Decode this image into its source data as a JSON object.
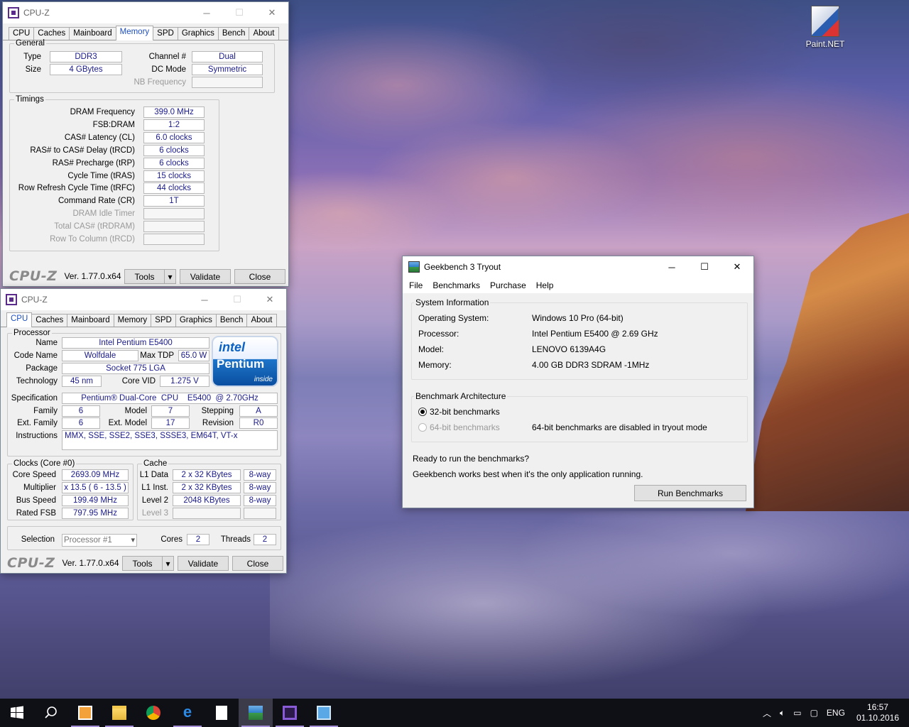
{
  "desktop": {
    "icon_label": "Paint.NET"
  },
  "cpuz_mem": {
    "title": "CPU-Z",
    "tabs": [
      "CPU",
      "Caches",
      "Mainboard",
      "Memory",
      "SPD",
      "Graphics",
      "Bench",
      "About"
    ],
    "general": {
      "legend": "General",
      "type_label": "Type",
      "type": "DDR3",
      "size_label": "Size",
      "size": "4 GBytes",
      "channel_label": "Channel #",
      "channel": "Dual",
      "dc_label": "DC Mode",
      "dc": "Symmetric",
      "nb_label": "NB Frequency",
      "nb": ""
    },
    "timings": {
      "legend": "Timings",
      "rows": [
        {
          "label": "DRAM Frequency",
          "value": "399.0 MHz",
          "disabled": false
        },
        {
          "label": "FSB:DRAM",
          "value": "1:2",
          "disabled": false
        },
        {
          "label": "CAS# Latency (CL)",
          "value": "6.0 clocks",
          "disabled": false
        },
        {
          "label": "RAS# to CAS# Delay (tRCD)",
          "value": "6 clocks",
          "disabled": false
        },
        {
          "label": "RAS# Precharge (tRP)",
          "value": "6 clocks",
          "disabled": false
        },
        {
          "label": "Cycle Time (tRAS)",
          "value": "15 clocks",
          "disabled": false
        },
        {
          "label": "Row Refresh Cycle Time (tRFC)",
          "value": "44 clocks",
          "disabled": false
        },
        {
          "label": "Command Rate (CR)",
          "value": "1T",
          "disabled": false
        },
        {
          "label": "DRAM Idle Timer",
          "value": "",
          "disabled": true
        },
        {
          "label": "Total CAS# (tRDRAM)",
          "value": "",
          "disabled": true
        },
        {
          "label": "Row To Column (tRCD)",
          "value": "",
          "disabled": true
        }
      ]
    },
    "footer": {
      "brand": "CPU-Z",
      "version": "Ver. 1.77.0.x64",
      "tools": "Tools",
      "validate": "Validate",
      "close": "Close"
    }
  },
  "cpuz_cpu": {
    "title": "CPU-Z",
    "tabs": [
      "CPU",
      "Caches",
      "Mainboard",
      "Memory",
      "SPD",
      "Graphics",
      "Bench",
      "About"
    ],
    "processor": {
      "legend": "Processor",
      "name_label": "Name",
      "name": "Intel Pentium E5400",
      "code_label": "Code Name",
      "code": "Wolfdale",
      "tdp_label": "Max TDP",
      "tdp": "65.0 W",
      "package_label": "Package",
      "package": "Socket 775 LGA",
      "tech_label": "Technology",
      "tech": "45 nm",
      "vid_label": "Core VID",
      "vid": "1.275 V",
      "spec_label": "Specification",
      "spec": "Pentium® Dual-Core  CPU    E5400  @ 2.70GHz",
      "family_label": "Family",
      "family": "6",
      "model_label": "Model",
      "model": "7",
      "stepping_label": "Stepping",
      "stepping": "A",
      "extfam_label": "Ext. Family",
      "extfam": "6",
      "extmod_label": "Ext. Model",
      "extmod": "17",
      "rev_label": "Revision",
      "rev": "R0",
      "instr_label": "Instructions",
      "instr": "MMX, SSE, SSE2, SSE3, SSSE3, EM64T, VT-x",
      "logo_brand": "intel",
      "logo_name": "Pentium",
      "logo_tag": "inside"
    },
    "clocks": {
      "legend": "Clocks (Core #0)",
      "core_label": "Core Speed",
      "core": "2693.09 MHz",
      "mult_label": "Multiplier",
      "mult": "x 13.5 ( 6 - 13.5 )",
      "bus_label": "Bus Speed",
      "bus": "199.49 MHz",
      "fsb_label": "Rated FSB",
      "fsb": "797.95 MHz"
    },
    "cache": {
      "legend": "Cache",
      "l1d_label": "L1 Data",
      "l1d": "2 x 32 KBytes",
      "l1d_way": "8-way",
      "l1i_label": "L1 Inst.",
      "l1i": "2 x 32 KBytes",
      "l1i_way": "8-way",
      "l2_label": "Level 2",
      "l2": "2048 KBytes",
      "l2_way": "8-way",
      "l3_label": "Level 3"
    },
    "selection": {
      "label": "Selection",
      "value": "Processor #1",
      "cores_label": "Cores",
      "cores": "2",
      "threads_label": "Threads",
      "threads": "2"
    },
    "footer": {
      "brand": "CPU-Z",
      "version": "Ver. 1.77.0.x64",
      "tools": "Tools",
      "validate": "Validate",
      "close": "Close"
    }
  },
  "geekbench": {
    "title": "Geekbench 3 Tryout",
    "menu": [
      "File",
      "Benchmarks",
      "Purchase",
      "Help"
    ],
    "sysinfo": {
      "heading": "System Information",
      "rows": [
        {
          "label": "Operating System:",
          "value": "Windows 10 Pro (64-bit)"
        },
        {
          "label": "Processor:",
          "value": "Intel Pentium E5400 @ 2.69 GHz"
        },
        {
          "label": "Model:",
          "value": "LENOVO 6139A4G"
        },
        {
          "label": "Memory:",
          "value": "4.00 GB DDR3 SDRAM -1MHz"
        }
      ]
    },
    "arch": {
      "heading": "Benchmark Architecture",
      "opt32": "32-bit benchmarks",
      "opt64": "64-bit benchmarks",
      "note64": "64-bit benchmarks are disabled in tryout mode"
    },
    "ready": "Ready to run the benchmarks?",
    "hint": "Geekbench works best when it's the only application running.",
    "run_button": "Run Benchmarks"
  },
  "taskbar": {
    "lang": "ENG",
    "time": "16:57",
    "date": "01.10.2016"
  }
}
